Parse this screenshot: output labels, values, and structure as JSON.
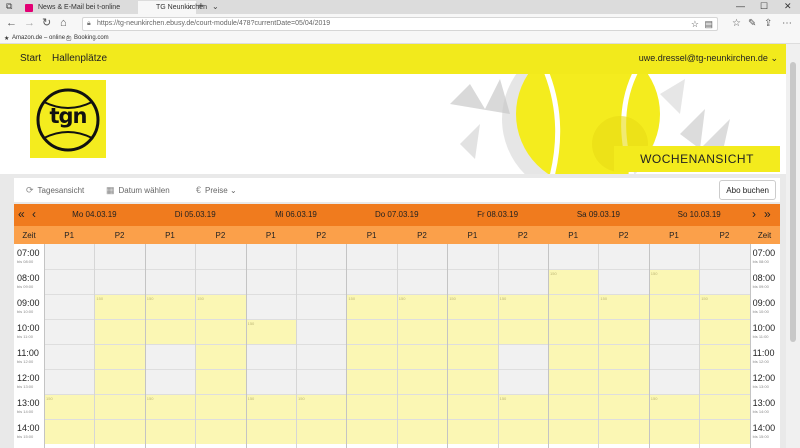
{
  "browser": {
    "tabs": [
      {
        "title": "News & E-Mail bei t-online",
        "active": false
      },
      {
        "title": "TG Neunkirchen",
        "active": true
      }
    ],
    "url": "https://tg-neunkirchen.ebusy.de/court-module/478?currentDate=05/04/2019",
    "bookmarks": [
      "Amazon.de – online s",
      "Booking.com"
    ]
  },
  "site": {
    "nav": {
      "start": "Start",
      "hallenplaetze": "Hallenplätze",
      "user": "uwe.dressel@tg-neunkirchen.de"
    },
    "logo_text": "tgn",
    "banner_label": "WOCHENANSICHT"
  },
  "toolbar": {
    "tagesansicht": "Tagesansicht",
    "datum": "Datum wählen",
    "preise": "Preise",
    "abo": "Abo buchen"
  },
  "calendar": {
    "days": [
      "Mo 04.03.19",
      "Di 05.03.19",
      "Mi 06.03.19",
      "Do 07.03.19",
      "Fr 08.03.19",
      "Sa 09.03.19",
      "So 10.03.19"
    ],
    "zeit_label": "Zeit",
    "courts": [
      "P1",
      "P2"
    ],
    "slot_label": "150",
    "times": [
      {
        "label": "07:00",
        "sub": "bis 08:00"
      },
      {
        "label": "08:00",
        "sub": "bis 09:00"
      },
      {
        "label": "09:00",
        "sub": "bis 10:00"
      },
      {
        "label": "10:00",
        "sub": "bis 11:00"
      },
      {
        "label": "11:00",
        "sub": "bis 12:00"
      },
      {
        "label": "12:00",
        "sub": "bis 13:00"
      },
      {
        "label": "13:00",
        "sub": "bis 14:00"
      },
      {
        "label": "14:00",
        "sub": "bis 15:00"
      }
    ],
    "booked": [
      {
        "day": 0,
        "court": 1,
        "from": 2,
        "to": 8
      },
      {
        "day": 1,
        "court": 0,
        "from": 2,
        "to": 4
      },
      {
        "day": 1,
        "court": 1,
        "from": 2,
        "to": 8
      },
      {
        "day": 2,
        "court": 0,
        "from": 3,
        "to": 4
      },
      {
        "day": 3,
        "court": 0,
        "from": 2,
        "to": 8
      },
      {
        "day": 3,
        "court": 1,
        "from": 2,
        "to": 8
      },
      {
        "day": 4,
        "court": 0,
        "from": 2,
        "to": 8
      },
      {
        "day": 4,
        "court": 1,
        "from": 2,
        "to": 4
      },
      {
        "day": 5,
        "court": 0,
        "from": 1,
        "to": 8
      },
      {
        "day": 5,
        "court": 1,
        "from": 2,
        "to": 8
      },
      {
        "day": 6,
        "court": 0,
        "from": 1,
        "to": 3
      },
      {
        "day": 6,
        "court": 1,
        "from": 2,
        "to": 8
      },
      {
        "day": 0,
        "court": 0,
        "from": 6,
        "to": 8
      },
      {
        "day": 1,
        "court": 0,
        "from": 6,
        "to": 8
      },
      {
        "day": 2,
        "court": 0,
        "from": 6,
        "to": 8
      },
      {
        "day": 2,
        "court": 1,
        "from": 6,
        "to": 8
      },
      {
        "day": 4,
        "court": 1,
        "from": 6,
        "to": 8
      },
      {
        "day": 6,
        "court": 0,
        "from": 6,
        "to": 8
      }
    ]
  }
}
